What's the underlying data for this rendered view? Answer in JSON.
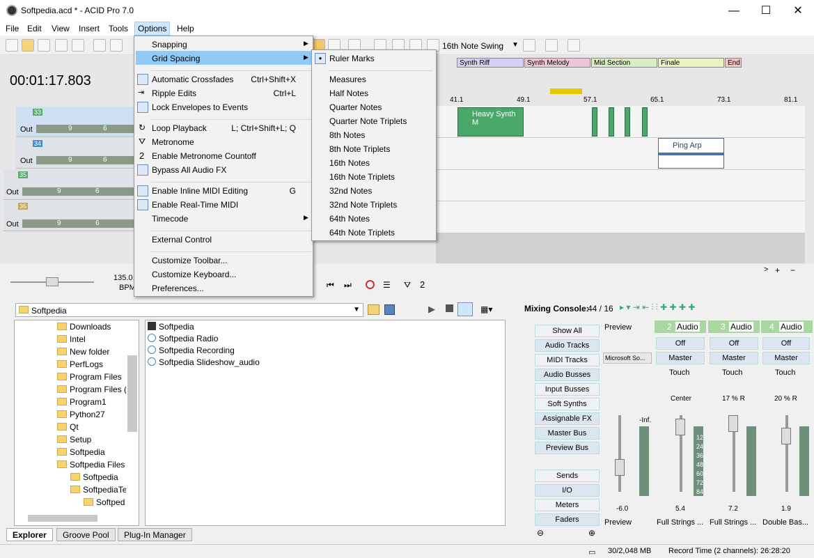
{
  "window": {
    "title": "Softpedia.acd * - ACID Pro 7.0",
    "minimize": "—",
    "maximize": "☐",
    "close": "✕"
  },
  "menubar": [
    "File",
    "Edit",
    "View",
    "Insert",
    "Tools",
    "Options",
    "Help"
  ],
  "toolbar": {
    "swing": "16th Note Swing"
  },
  "time_display": "00:01:17.803",
  "markers": [
    "Synth Riff",
    "Synth Melody",
    "Mid Section",
    "Finale",
    "End"
  ],
  "ruler_ticks": [
    "41.1",
    "49.1",
    "57.1",
    "65.1",
    "73.1",
    "81.1"
  ],
  "tracks": [
    {
      "num": "33",
      "out": "Out",
      "vol": "9",
      "pan": "6"
    },
    {
      "num": "34",
      "out": "Out",
      "vol": "9",
      "pan": "6"
    },
    {
      "num": "35",
      "out": "Out",
      "vol": "9",
      "pan": "6"
    },
    {
      "num": "36",
      "out": "Out",
      "vol": "9",
      "pan": "6"
    }
  ],
  "clips": [
    "Heavy Synth M",
    "Ping Arp"
  ],
  "tempo": {
    "value": "135.0",
    "unit": "BPM"
  },
  "options_menu": {
    "items": [
      {
        "label": "Snapping",
        "shortcut": "",
        "submenu": true
      },
      {
        "label": "Grid Spacing",
        "shortcut": "",
        "submenu": true
      },
      {
        "label": "Automatic Crossfades",
        "shortcut": "Ctrl+Shift+X"
      },
      {
        "label": "Ripple Edits",
        "shortcut": "Ctrl+L"
      },
      {
        "label": "Lock Envelopes to Events",
        "shortcut": ""
      },
      {
        "label": "Loop Playback",
        "shortcut": "L; Ctrl+Shift+L; Q"
      },
      {
        "label": "Metronome",
        "shortcut": ""
      },
      {
        "label": "Enable Metronome Countoff",
        "shortcut": ""
      },
      {
        "label": "Bypass All Audio FX",
        "shortcut": ""
      },
      {
        "label": "Enable Inline MIDI Editing",
        "shortcut": "G"
      },
      {
        "label": "Enable Real-Time MIDI",
        "shortcut": ""
      },
      {
        "label": "Timecode",
        "shortcut": "",
        "submenu": true
      },
      {
        "label": "External Control",
        "shortcut": ""
      },
      {
        "label": "Customize Toolbar...",
        "shortcut": ""
      },
      {
        "label": "Customize Keyboard...",
        "shortcut": ""
      },
      {
        "label": "Preferences...",
        "shortcut": ""
      }
    ]
  },
  "grid_submenu": [
    "Ruler Marks",
    "Measures",
    "Half Notes",
    "Quarter Notes",
    "Quarter Note Triplets",
    "8th Notes",
    "8th Note Triplets",
    "16th Notes",
    "16th Note Triplets",
    "32nd Notes",
    "32nd Note Triplets",
    "64th Notes",
    "64th Note Triplets"
  ],
  "explorer": {
    "path": "Softpedia",
    "tree": [
      "Downloads",
      "Intel",
      "New folder",
      "PerfLogs",
      "Program Files",
      "Program Files (x",
      "Program1",
      "Python27",
      "Qt",
      "Setup",
      "Softpedia",
      "Softpedia Files",
      "Softpedia",
      "SoftpediaTe",
      "Softped"
    ],
    "files": [
      "Softpedia",
      "Softpedia Radio",
      "Softpedia Recording",
      "Softpedia Slideshow_audio"
    ],
    "tabs": [
      "Explorer",
      "Groove Pool",
      "Plug-In Manager"
    ]
  },
  "mixer": {
    "title": "Mixing Console:",
    "count": "44 / 16",
    "buttons": [
      "Show All",
      "Audio Tracks",
      "MIDI Tracks",
      "Audio Busses",
      "Input Busses",
      "Soft Synths",
      "Assignable FX",
      "Master Bus",
      "Preview Bus",
      "Sends",
      "I/O",
      "Meters",
      "Faders"
    ],
    "preview": {
      "label": "Preview",
      "device": "Microsoft So...",
      "value": "-6.0",
      "inf": "-Inf."
    },
    "strips": [
      {
        "num": "2",
        "name": "Audio",
        "off": "Off",
        "master": "Master",
        "touch": "Touch",
        "pan": "Center",
        "value": "5.4",
        "bottom": "Full Strings ..."
      },
      {
        "num": "3",
        "name": "Audio",
        "off": "Off",
        "master": "Master",
        "touch": "Touch",
        "pan": "17 % R",
        "value": "7.2",
        "bottom": "Full Strings ..."
      },
      {
        "num": "4",
        "name": "Audio",
        "off": "Off",
        "master": "Master",
        "touch": "Touch",
        "pan": "20 % R",
        "value": "1.9",
        "bottom": "Double Bas..."
      }
    ],
    "meter_scale": [
      "12",
      "24",
      "36",
      "48",
      "60",
      "72",
      "84"
    ]
  },
  "status": {
    "memory": "30/2,048 MB",
    "record": "Record Time (2 channels): 26:28:20"
  }
}
